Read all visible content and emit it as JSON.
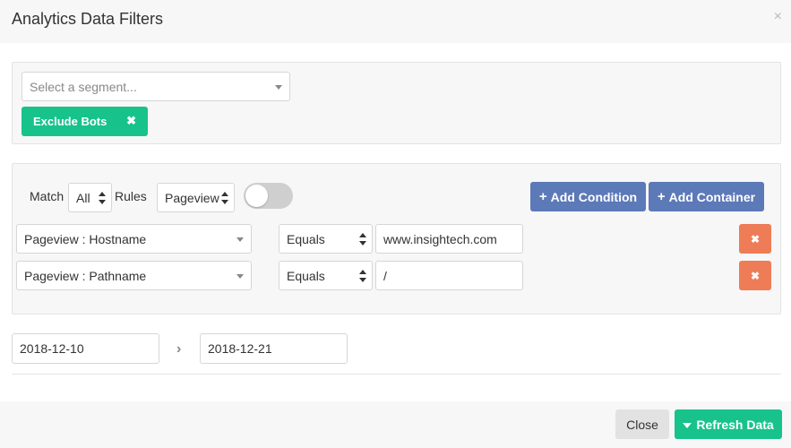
{
  "modal": {
    "title": "Analytics Data Filters",
    "close_glyph": "×"
  },
  "segment": {
    "placeholder": "Select a segment...",
    "tags": [
      {
        "label": "Exclude Bots",
        "remove_glyph": "✖"
      }
    ]
  },
  "rules": {
    "match_label": "Match",
    "match_value": "All",
    "rules_label": "Rules",
    "scope_value": "Pageview",
    "toggle_on": false,
    "add_condition_label": "Add Condition",
    "add_container_label": "Add Container",
    "plus_glyph": "+",
    "conditions": [
      {
        "field": "Pageview : Hostname",
        "operator": "Equals",
        "value": "www.insightech.com",
        "remove_glyph": "✖"
      },
      {
        "field": "Pageview : Pathname",
        "operator": "Equals",
        "value": "/",
        "remove_glyph": "✖"
      }
    ]
  },
  "date_range": {
    "start": "2018-12-10",
    "arrow_glyph": "›",
    "end": "2018-12-21"
  },
  "footer": {
    "close_label": "Close",
    "refresh_label": "Refresh Data"
  },
  "colors": {
    "green": "#17c38a",
    "blue": "#5c79b8",
    "orange": "#ee7c56"
  },
  "icons": [
    "close-icon",
    "chevron-down-icon",
    "plus-icon",
    "filter-icon",
    "arrow-right-icon"
  ]
}
